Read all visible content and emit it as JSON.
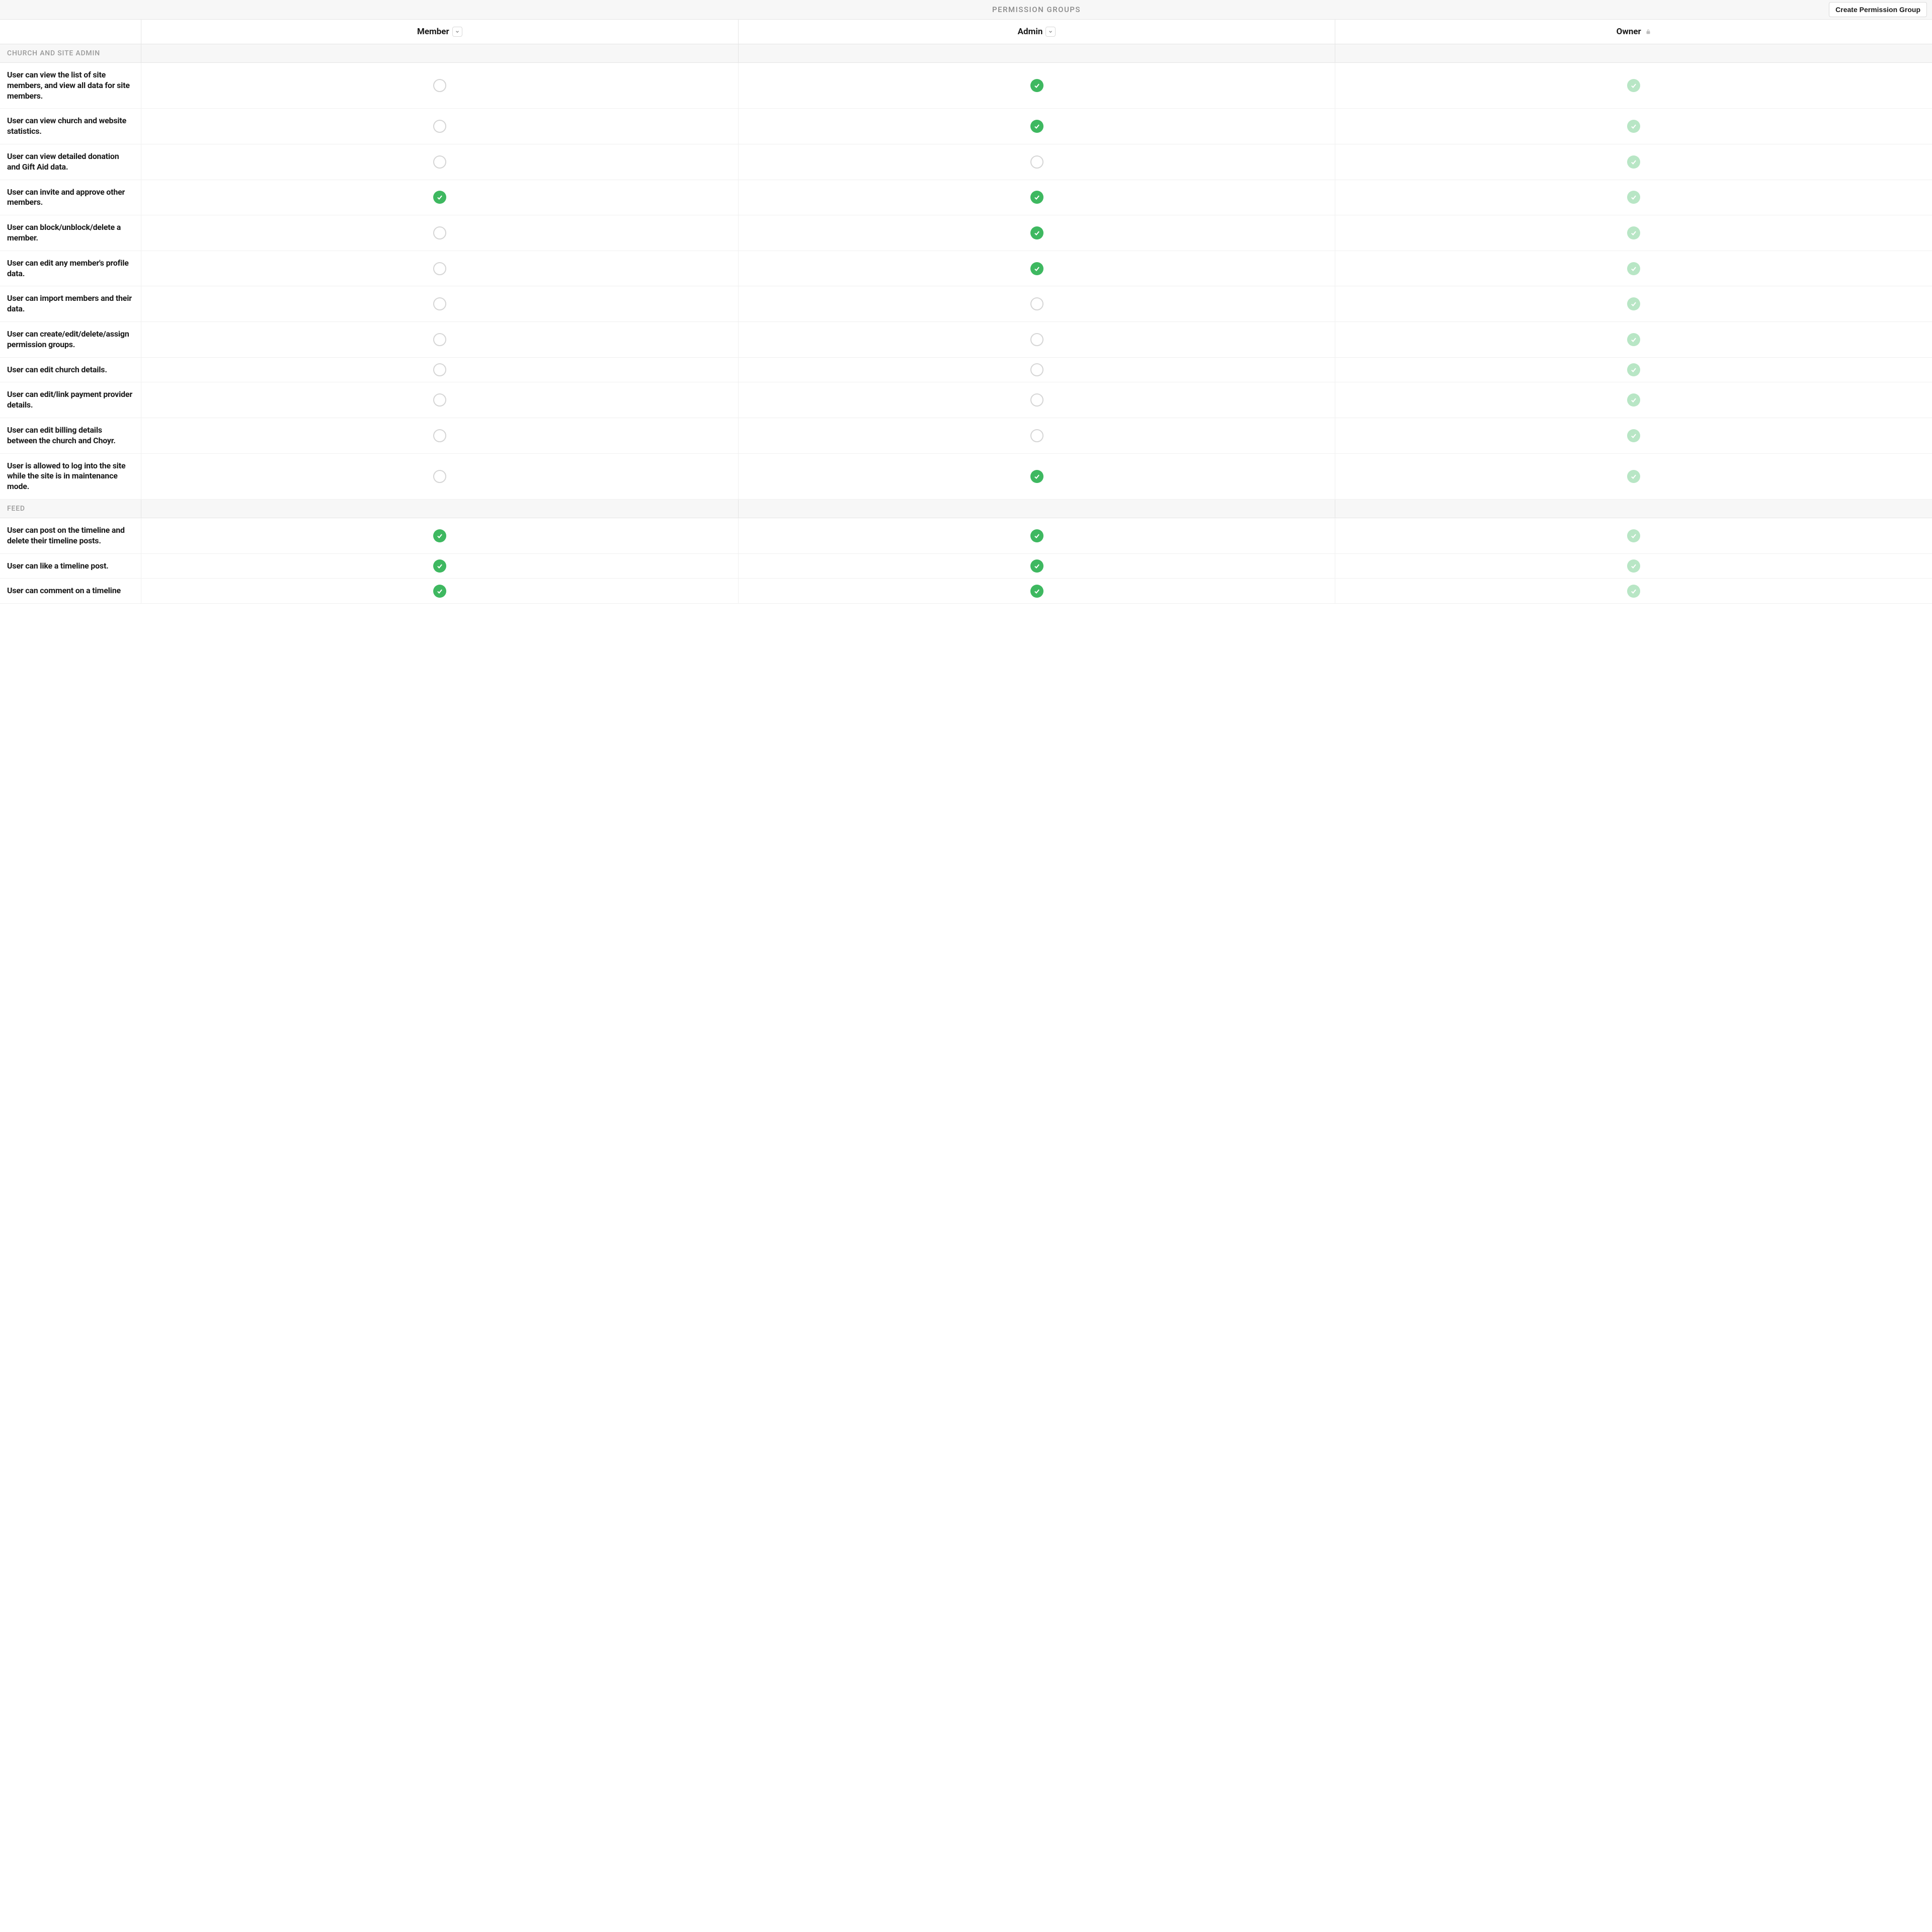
{
  "header": {
    "title": "PERMISSION GROUPS",
    "create_button": "Create Permission Group"
  },
  "groups": [
    {
      "name": "Member",
      "editable": true
    },
    {
      "name": "Admin",
      "editable": true
    },
    {
      "name": "Owner",
      "editable": false
    }
  ],
  "sections": [
    {
      "title": "CHURCH AND SITE ADMIN",
      "permissions": [
        {
          "label": "User can view the list of site members, and view all data for site members.",
          "values": [
            "empty",
            "checked",
            "locked"
          ]
        },
        {
          "label": "User can view church and website statistics.",
          "values": [
            "empty",
            "checked",
            "locked"
          ]
        },
        {
          "label": "User can view detailed donation and Gift Aid data.",
          "values": [
            "empty",
            "empty",
            "locked"
          ]
        },
        {
          "label": "User can invite and approve other members.",
          "values": [
            "checked",
            "checked",
            "locked"
          ]
        },
        {
          "label": "User can block/unblock/delete a member.",
          "values": [
            "empty",
            "checked",
            "locked"
          ]
        },
        {
          "label": "User can edit any member's profile data.",
          "values": [
            "empty",
            "checked",
            "locked"
          ]
        },
        {
          "label": "User can import members and their data.",
          "values": [
            "empty",
            "empty",
            "locked"
          ]
        },
        {
          "label": "User can create/edit/delete/assign permission groups.",
          "values": [
            "empty",
            "empty",
            "locked"
          ]
        },
        {
          "label": "User can edit church details.",
          "values": [
            "empty",
            "empty",
            "locked"
          ]
        },
        {
          "label": "User can edit/link payment provider details.",
          "values": [
            "empty",
            "empty",
            "locked"
          ]
        },
        {
          "label": "User can edit billing details between the church and Choyr.",
          "values": [
            "empty",
            "empty",
            "locked"
          ]
        },
        {
          "label": "User is allowed to log into the site while the site is in maintenance mode.",
          "values": [
            "empty",
            "checked",
            "locked"
          ]
        }
      ]
    },
    {
      "title": "FEED",
      "permissions": [
        {
          "label": "User can post on the timeline and delete their timeline posts.",
          "values": [
            "checked",
            "checked",
            "locked"
          ]
        },
        {
          "label": "User can like a timeline post.",
          "values": [
            "checked",
            "checked",
            "locked"
          ]
        },
        {
          "label": "User can comment on a timeline",
          "values": [
            "checked",
            "checked",
            "locked"
          ]
        }
      ]
    }
  ]
}
